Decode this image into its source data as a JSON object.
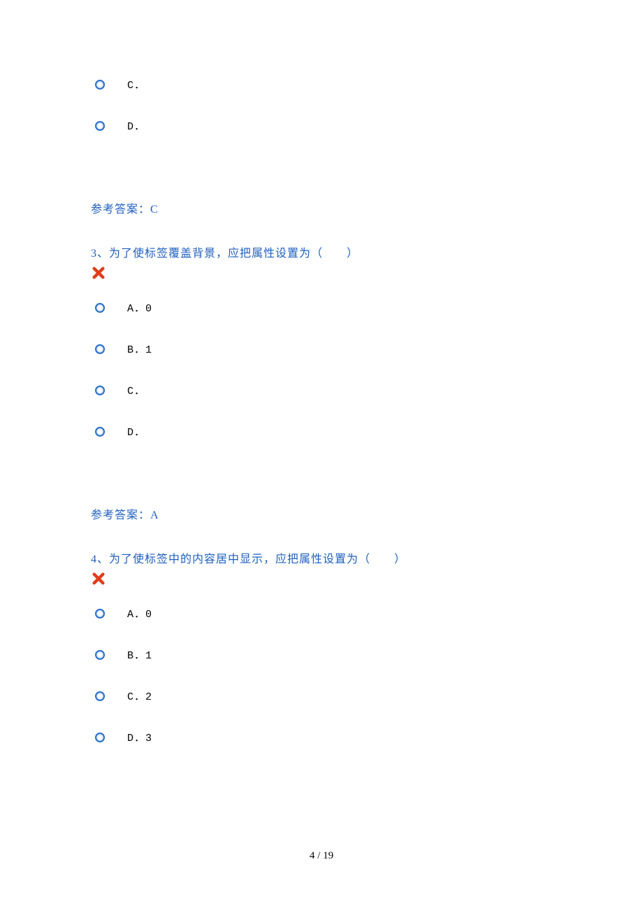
{
  "q_prev": {
    "options": [
      {
        "label": "C．"
      },
      {
        "label": "D．"
      }
    ],
    "answer_label": "参考答案：",
    "answer_value": "C"
  },
  "q3": {
    "number": "3、",
    "text": "为了使标签覆盖背景，应把属性设置为（　　）",
    "options": [
      {
        "label": "A．0"
      },
      {
        "label": "B．1"
      },
      {
        "label": "C．"
      },
      {
        "label": "D．"
      }
    ],
    "answer_label": "参考答案：",
    "answer_value": "A"
  },
  "q4": {
    "number": "4、",
    "text": "为了使标签中的内容居中显示，应把属性设置为（　　）",
    "options": [
      {
        "label": "A．0"
      },
      {
        "label": "B．1"
      },
      {
        "label": "C．2"
      },
      {
        "label": "D．3"
      }
    ]
  },
  "footer": {
    "page_current": "4",
    "page_sep": " / ",
    "page_total": "19"
  }
}
